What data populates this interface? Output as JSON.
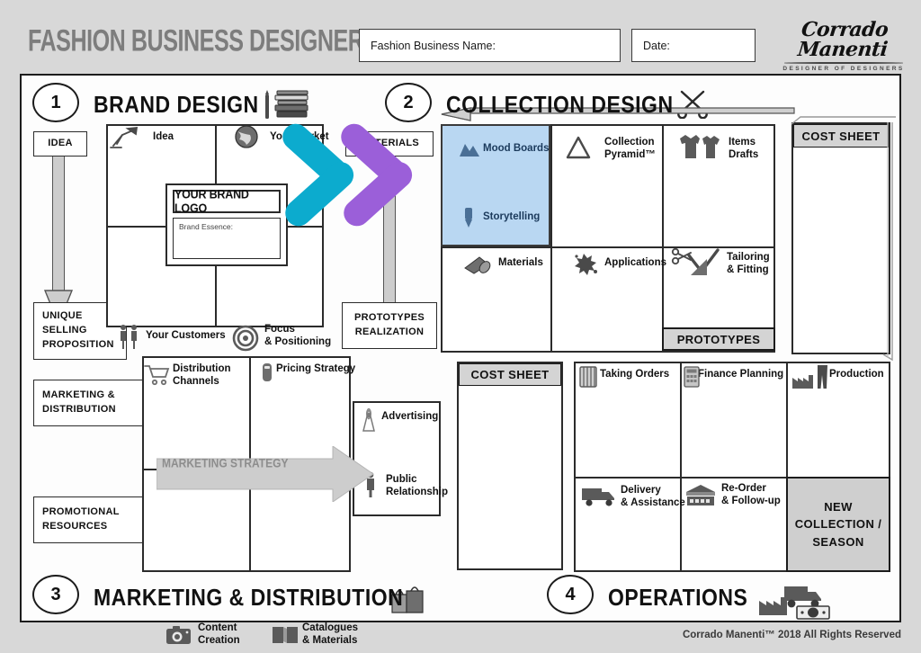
{
  "header": {
    "title": "FASHION BUSINESS DESIGNER",
    "business_name_label": "Fashion Business Name:",
    "date_label": "Date:",
    "logo_name": "Corrado Manenti",
    "logo_tagline": "DESIGNER OF    DESIGNERS"
  },
  "colors": {
    "cyan_chevron": "#0cabce",
    "purple_chevron": "#9b5fd9",
    "mood_highlight": "#b9d7f2",
    "gray_fill": "#cfcfcf",
    "title_gray": "#7d7d7d"
  },
  "sections": [
    {
      "number": "1",
      "title": "BRAND DESIGN",
      "icon": "books-icon"
    },
    {
      "number": "2",
      "title": "COLLECTION DESIGN",
      "icon": "scissors-icon"
    },
    {
      "number": "3",
      "title": "MARKETING & DISTRIBUTION",
      "icon": "shopping-bags-icon"
    },
    {
      "number": "4",
      "title": "OPERATIONS",
      "icon": "factory-truck-money-icon"
    }
  ],
  "brand_design": {
    "idea_label": "IDEA",
    "usp_label": "UNIQUE\nSELLING\nPROPOSITION",
    "cells": [
      {
        "label": "Idea",
        "icon": "desk-lamp-icon"
      },
      {
        "label": "Your Market",
        "icon": "globe-icon"
      },
      {
        "label": "Your Customers",
        "icon": "people-icon"
      },
      {
        "label": "Focus\n& Positioning",
        "icon": "target-icon"
      }
    ],
    "brand_logo_label": "YOUR BRAND LOGO",
    "brand_essence_label": "Brand Essence:"
  },
  "bridge": {
    "materials_label": "MATERIALS",
    "prototypes_realization_label": "PROTOTYPES\nREALIZATION",
    "cost_sheet_label": "COST SHEET"
  },
  "collection_design": {
    "cells": [
      {
        "label": "Mood Boards",
        "icon": "mountains-icon",
        "highlighted": true
      },
      {
        "label": "Storytelling",
        "icon": "pen-icon",
        "highlighted": true
      },
      {
        "label": "Collection\nPyramid™",
        "icon": "triangle-icon"
      },
      {
        "label": "Items\nDrafts",
        "icon": "tshirts-icon"
      },
      {
        "label": "Materials",
        "icon": "fabric-roll-icon"
      },
      {
        "label": "Applications",
        "icon": "splash-icon"
      },
      {
        "label": "Tailoring\n& Fitting",
        "icon": "scissors-ruler-icon"
      }
    ],
    "prototypes_badge": "PROTOTYPES",
    "cost_sheet_label": "COST SHEET"
  },
  "marketing": {
    "md_label": "MARKETING &\nDISTRIBUTION",
    "promo_label": "PROMOTIONAL\nRESOURCES",
    "strategy_arrow_label": "MARKETING STRATEGY",
    "cells": [
      {
        "label": "Distribution\nChannels",
        "icon": "cart-icon"
      },
      {
        "label": "Pricing Strategy",
        "icon": "price-tag-icon"
      },
      {
        "label": "Content\nCreation",
        "icon": "camera-icon"
      },
      {
        "label": "Catalogues\n& Materials",
        "icon": "book-icon"
      },
      {
        "label": "Advertising",
        "icon": "antenna-icon"
      },
      {
        "label": "Public\nRelationship",
        "icon": "person-icon"
      }
    ],
    "cost_sheet_label": "COST SHEET"
  },
  "operations": {
    "cells": [
      {
        "label": "Taking Orders",
        "icon": "ledger-icon"
      },
      {
        "label": "Finance Planning",
        "icon": "calculator-icon"
      },
      {
        "label": "Production",
        "icon": "factory-trousers-icon"
      },
      {
        "label": "Delivery\n& Assistance",
        "icon": "truck-icon"
      },
      {
        "label": "Re-Order\n& Follow-up",
        "icon": "shop-icon"
      }
    ],
    "new_collection_label": "NEW\nCOLLECTION /\nSEASON"
  },
  "footer": {
    "copyright": "Corrado Manenti™ 2018 All Rights Reserved"
  }
}
